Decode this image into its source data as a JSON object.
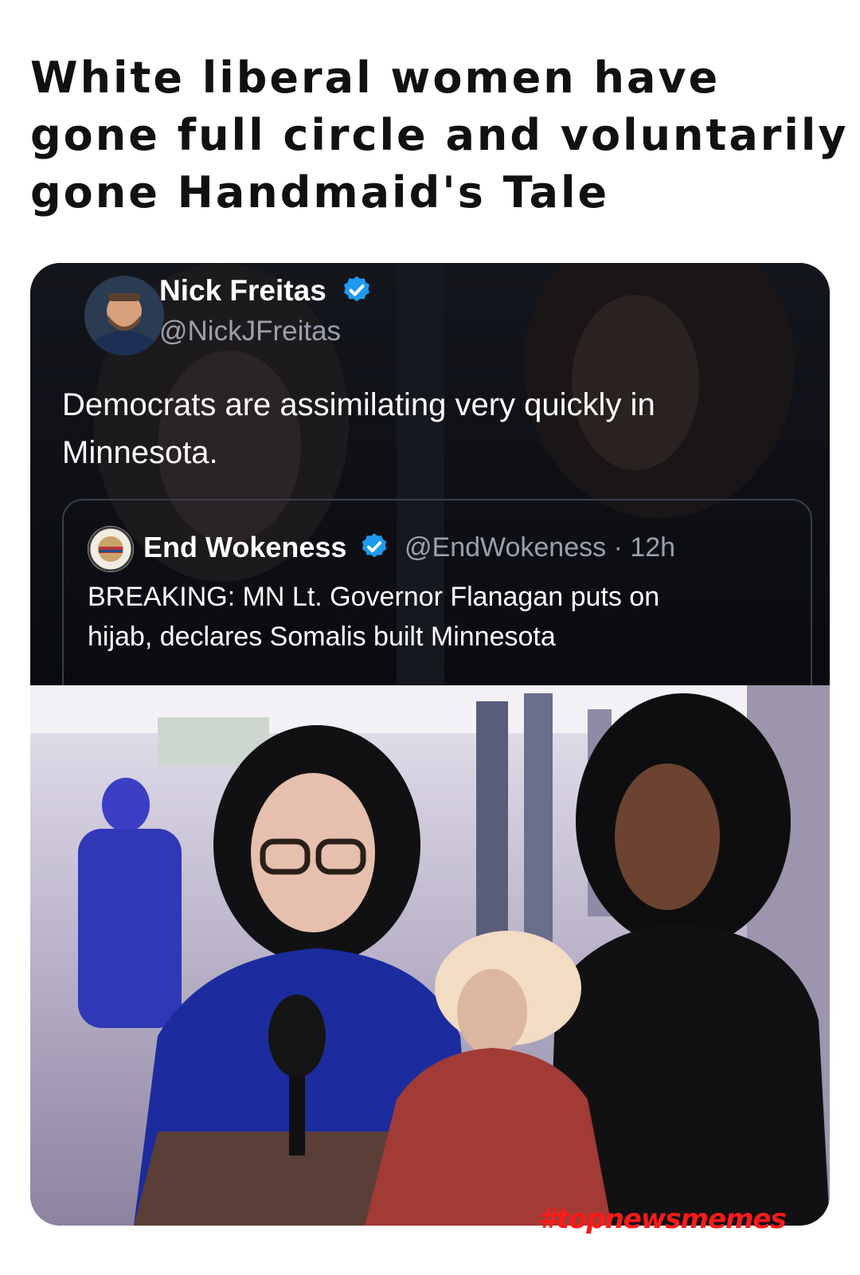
{
  "meme": {
    "title_lines": [
      "White liberal women have",
      "gone full circle and voluntarily",
      "gone Handmaid's Tale"
    ],
    "watermark": "#topnewsmemes"
  },
  "tweet": {
    "author_name": "Nick Freitas",
    "author_handle": "@NickJFreitas",
    "text_lines": [
      "Democrats are assimilating very quickly in",
      "Minnesota."
    ],
    "verified_color": "#1d9bf0"
  },
  "quoted_tweet": {
    "author_name": "End Wokeness",
    "author_handle": "@EndWokeness",
    "timestamp": "12h",
    "meta": "@EndWokeness · 12h",
    "text_lines": [
      "BREAKING: MN Lt. Governor Flanagan puts on",
      "hijab, declares Somalis built Minnesota"
    ]
  },
  "icons": {
    "verified": "verified-badge-icon"
  },
  "colors": {
    "watermark": "#ff1a1a",
    "card_background": "#0c0d12"
  }
}
